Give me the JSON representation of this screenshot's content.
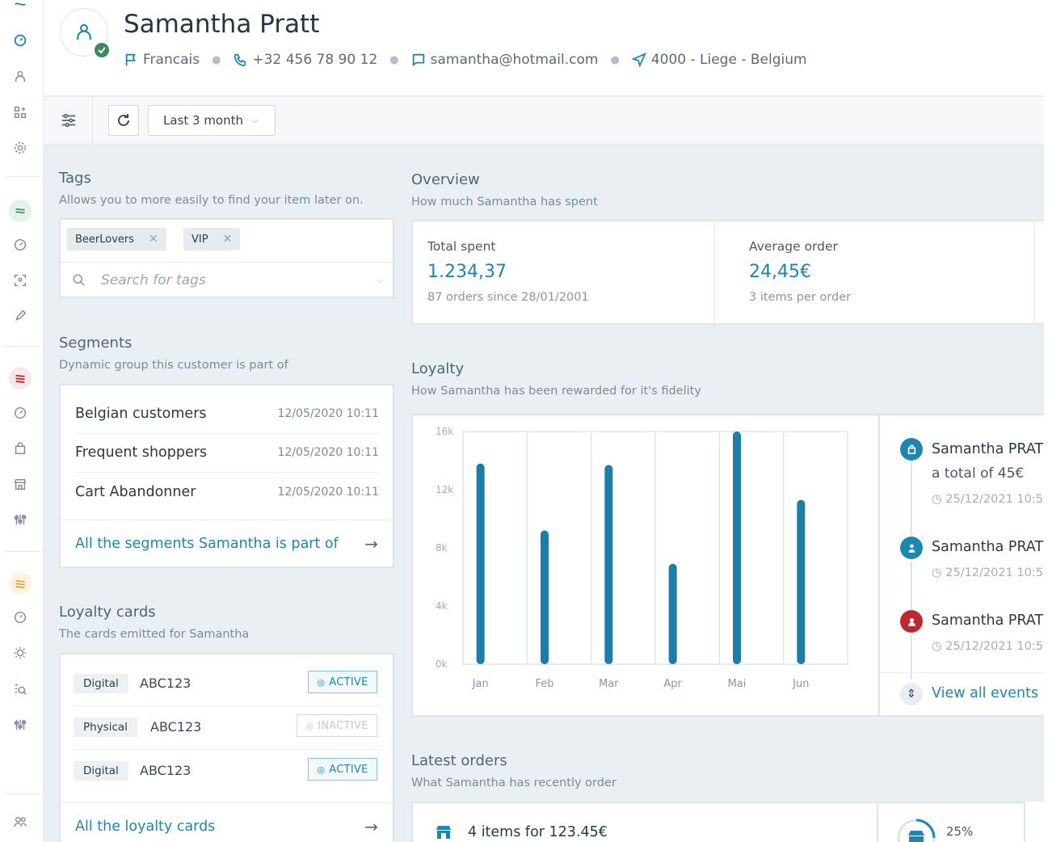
{
  "customer": {
    "name": "Samantha Pratt",
    "language": "Francais",
    "phone": "+32 456 78 90 12",
    "email": "samantha@hotmail.com",
    "location": "4000 - Liege - Belgium"
  },
  "toolbar": {
    "range_label": "Last 3 month"
  },
  "tags": {
    "title": "Tags",
    "subtitle": "Allows you to more easily to find your item later on.",
    "items": [
      "BeerLovers",
      "VIP"
    ],
    "search_placeholder": "Search for tags"
  },
  "segments": {
    "title": "Segments",
    "subtitle": "Dynamic group this customer is part of",
    "rows": [
      {
        "name": "Belgian customers",
        "date": "12/05/2020 10:11"
      },
      {
        "name": "Frequent shoppers",
        "date": "12/05/2020 10:11"
      },
      {
        "name": "Cart Abandonner",
        "date": "12/05/2020 10:11"
      }
    ],
    "link": "All the segments Samantha is part of"
  },
  "loyalty_cards": {
    "title": "Loyalty cards",
    "subtitle": "The cards emitted for Samantha",
    "rows": [
      {
        "type": "Digital",
        "code": "ABC123",
        "status": "ACTIVE"
      },
      {
        "type": "Physical",
        "code": "ABC123",
        "status": "INACTIVE"
      },
      {
        "type": "Digital",
        "code": "ABC123",
        "status": "ACTIVE"
      }
    ],
    "link": "All the loyalty cards"
  },
  "overview": {
    "title": "Overview",
    "subtitle": "How much Samantha has spent",
    "total_label": "Total spent",
    "total_value": "1.234,37",
    "total_note": "87 orders since 28/01/2001",
    "avg_label": "Average order",
    "avg_value": "24,45€",
    "avg_note": "3 items per order"
  },
  "loyalty": {
    "title": "Loyalty",
    "subtitle": "How Samantha has been rewarded for it's fidelity"
  },
  "chart_data": {
    "type": "bar",
    "categories": [
      "Jan",
      "Feb",
      "Mar",
      "Apr",
      "Mai",
      "Jun"
    ],
    "values": [
      13800,
      9200,
      13700,
      6900,
      16000,
      11300
    ],
    "ylim": [
      0,
      16000
    ],
    "yticks": [
      "0k",
      "4k",
      "8k",
      "12k",
      "16k"
    ],
    "grid": true,
    "bar_color": "#1a7fa8"
  },
  "events": {
    "items": [
      {
        "name": "Samantha PRAT",
        "detail": "a total of 45€",
        "time": "25/12/2021 10:5",
        "icon": "bag-icon",
        "color": "#1a87b4"
      },
      {
        "name": "Samantha PRAT",
        "time": "25/12/2021 10:5",
        "icon": "user-icon",
        "color": "#1a87b4"
      },
      {
        "name": "Samantha PRAT",
        "time": "25/12/2021 10:5",
        "icon": "alert-icon",
        "color": "#c0282f"
      }
    ],
    "link": "View all events"
  },
  "orders": {
    "title": "Latest orders",
    "subtitle": "What Samantha has recently order",
    "first": "4 items for 123.45€",
    "percent": "25%"
  },
  "colors": {
    "accent": "#1a87b4",
    "success": "#3b8a5a",
    "danger": "#c0282f"
  }
}
